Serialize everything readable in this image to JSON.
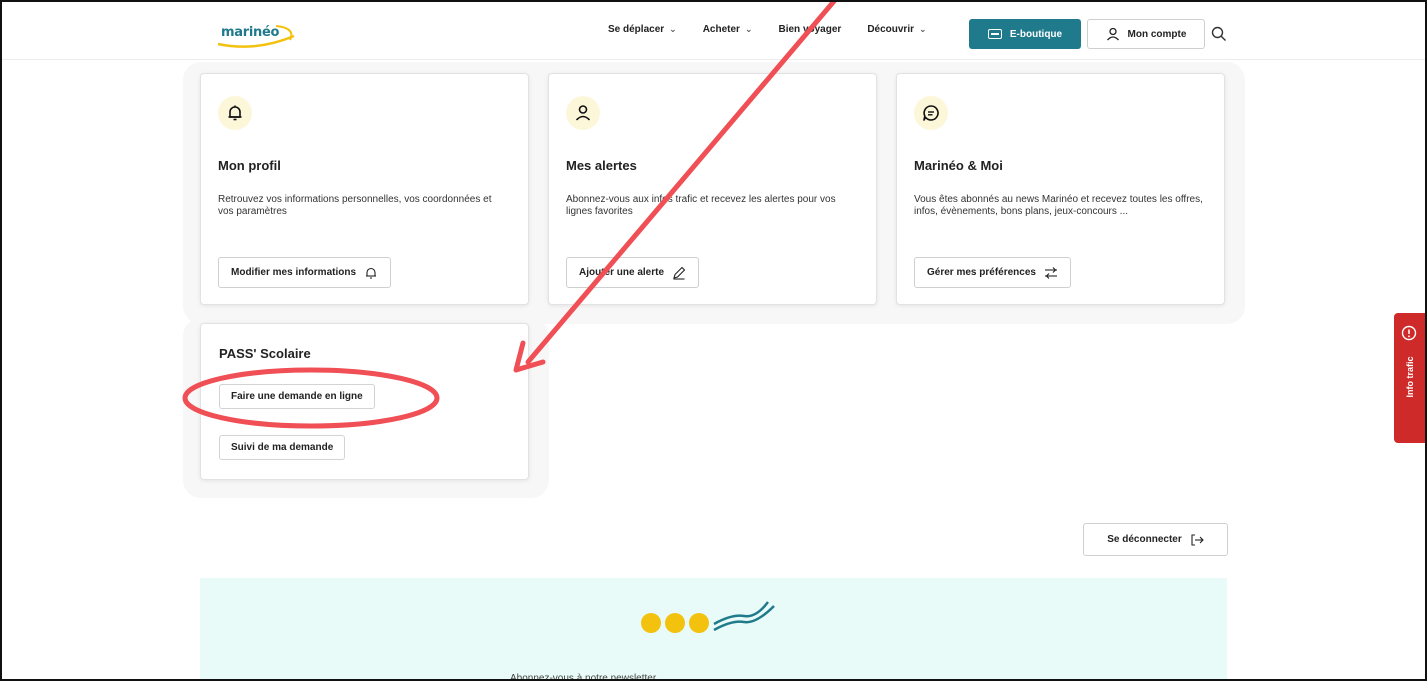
{
  "header": {
    "logo_text": "marinéo",
    "nav": [
      {
        "label": "Se déplacer",
        "has_chevron": true
      },
      {
        "label": "Acheter",
        "has_chevron": true
      },
      {
        "label": "Bien voyager",
        "has_chevron": false
      },
      {
        "label": "Découvrir",
        "has_chevron": true
      }
    ],
    "eboutique_label": "E-boutique",
    "account_label": "Mon compte",
    "search_icon": "search-icon"
  },
  "cards": [
    {
      "icon": "bell-icon",
      "title": "Mon profil",
      "description": "Retrouvez vos informations personnelles, vos coordonnées et vos paramètres",
      "button_label": "Modifier mes informations",
      "button_icon": "bell-outline-icon"
    },
    {
      "icon": "user-icon",
      "title": "Mes alertes",
      "description": "Abonnez-vous aux infos trafic et recevez les alertes pour vos lignes favorites",
      "button_label": "Ajouter une alerte",
      "button_icon": "pencil-icon"
    },
    {
      "icon": "chat-icon",
      "title": "Marinéo & Moi",
      "description": "Vous êtes abonnés au news Marinéo et recevez toutes les offres, infos, évènements, bons plans, jeux-concours ...",
      "button_label": "Gérer mes préférences",
      "button_icon": "sliders-icon"
    }
  ],
  "pass": {
    "title": "PASS' Scolaire",
    "btn_request": "Faire une demande en ligne",
    "btn_follow": "Suivi de ma demande"
  },
  "logout_label": "Se déconnecter",
  "newsletter_label": "Abonnez-vous à notre newsletter",
  "info_trafic_label": "Info trafic",
  "colors": {
    "primary": "#1f7a8c",
    "accent_yellow": "#f2c20f",
    "alert_red": "#cf2a2a",
    "annotation_red": "#ef4f55",
    "newsletter_bg": "#e9fbf8"
  }
}
